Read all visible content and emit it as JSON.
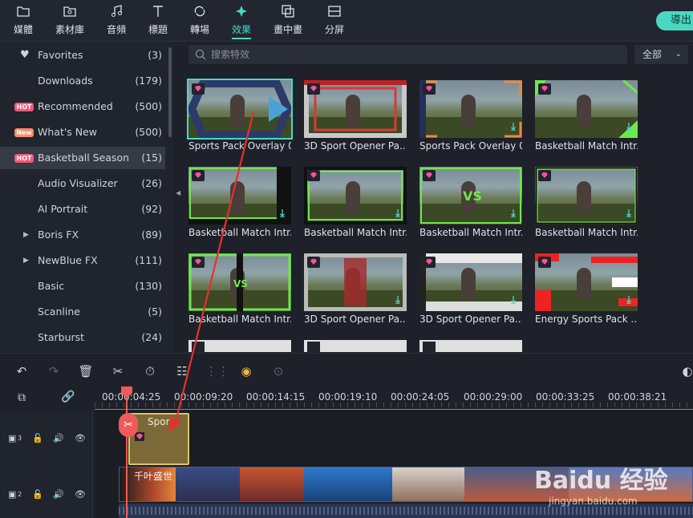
{
  "topbar": {
    "tabs": [
      {
        "label": "媒體",
        "icon": "folder-icon"
      },
      {
        "label": "素材庫",
        "icon": "image-folder-icon"
      },
      {
        "label": "音頻",
        "icon": "music-note-icon"
      },
      {
        "label": "標題",
        "icon": "text-t-icon"
      },
      {
        "label": "轉場",
        "icon": "transition-icon"
      },
      {
        "label": "效果",
        "icon": "effects-sparkle-icon",
        "active": true
      },
      {
        "label": "畫中畫",
        "icon": "pip-icon"
      },
      {
        "label": "分屏",
        "icon": "split-screen-icon"
      }
    ],
    "export_label": "導出"
  },
  "sidebar": {
    "items": [
      {
        "label": "Favorites",
        "count": "(3)",
        "icon": "heart-icon"
      },
      {
        "label": "Downloads",
        "count": "(179)"
      },
      {
        "label": "Recommended",
        "count": "(500)",
        "badge": "HOT"
      },
      {
        "label": "What's New",
        "count": "(500)",
        "badge": "New"
      },
      {
        "label": "Basketball Season",
        "count": "(15)",
        "badge": "HOT",
        "selected": true
      },
      {
        "label": "Audio Visualizer",
        "count": "(26)"
      },
      {
        "label": "AI Portrait",
        "count": "(92)"
      },
      {
        "label": "Boris FX",
        "count": "(89)",
        "expandable": true
      },
      {
        "label": "NewBlue FX",
        "count": "(111)",
        "expandable": true
      },
      {
        "label": "Basic",
        "count": "(130)"
      },
      {
        "label": "Scanline",
        "count": "(5)"
      },
      {
        "label": "Starburst",
        "count": "(24)"
      }
    ]
  },
  "search": {
    "placeholder": "搜索特效"
  },
  "filter": {
    "value": "全部"
  },
  "effects": [
    {
      "title": "Sports Pack Overlay 02",
      "style": "hexring",
      "selected": true
    },
    {
      "title": "3D Sport Opener Pa...",
      "style": "redframe"
    },
    {
      "title": "Sports Pack Overlay 01",
      "style": "orangecorner",
      "download": true
    },
    {
      "title": "Basketball Match Intr...",
      "style": "greenslash",
      "download": true
    },
    {
      "title": "Basketball Match Intr...",
      "style": "greenbar",
      "download": true
    },
    {
      "title": "Basketball Match Intr...",
      "style": "greenframe",
      "download": true
    },
    {
      "title": "Basketball Match Intr...",
      "style": "vs",
      "download": true
    },
    {
      "title": "Basketball Match Intr...",
      "style": "greenthin",
      "download": true
    },
    {
      "title": "Basketball Match Intr...",
      "style": "vssplit"
    },
    {
      "title": "3D Sport Opener Pa...",
      "style": "arena",
      "download": true
    },
    {
      "title": "3D Sport Opener Pa...",
      "style": "stage",
      "download": true
    },
    {
      "title": "Energy Sports Pack ...",
      "style": "redglitch",
      "download": true
    }
  ],
  "timeline": {
    "ruler": [
      "00:00:04:25",
      "00:00:09:20",
      "00:00:14:15",
      "00:00:19:10",
      "00:00:24:05",
      "00:00:29:00",
      "00:00:33:25",
      "00:00:38:21"
    ],
    "tracks": [
      {
        "number": "3",
        "clip": "Spor..."
      },
      {
        "number": "2",
        "clip": "千叶盛世"
      }
    ]
  },
  "watermark": {
    "brand": "Baidu 经验",
    "url": "jingyan.baidu.com"
  },
  "colors": {
    "accent": "#4ad8c2",
    "playhead": "#ef5a5a",
    "effect_clip": "#7b6a38"
  }
}
